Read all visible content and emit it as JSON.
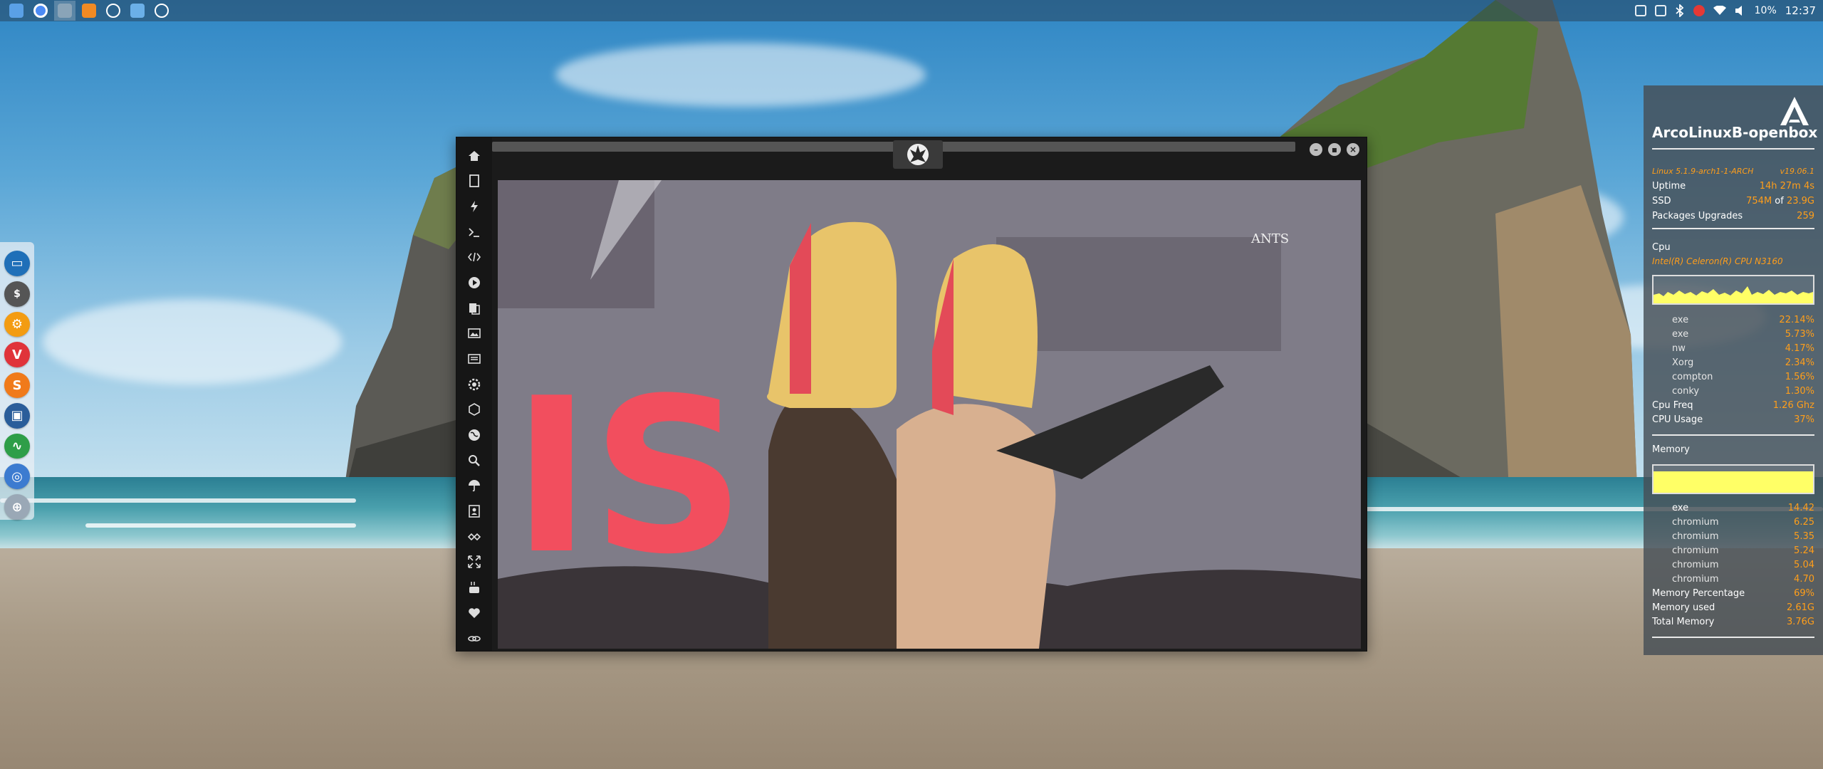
{
  "top_panel": {
    "launchers": [
      "file-manager-icon",
      "chrome-icon",
      "workspace-icon",
      "sublime-icon",
      "terminal-icon",
      "folder-icon",
      "screenshot-icon"
    ],
    "volume": "10%",
    "clock": "12:37"
  },
  "dock": {
    "items": [
      "file-manager-icon",
      "terminal-icon",
      "settings-icon",
      "vivaldi-icon",
      "sublime-icon",
      "workspace-icon",
      "system-monitor-icon",
      "chrome-icon",
      "network-icon"
    ]
  },
  "window": {
    "sidebar_icons": [
      "home-icon",
      "document-icon",
      "lightning-icon",
      "terminal-icon",
      "code-icon",
      "play-icon",
      "files-icon",
      "image-icon",
      "news-icon",
      "settings-icon",
      "hexagon-icon",
      "globe-icon",
      "search-icon",
      "umbrella-icon",
      "contact-icon",
      "sync-icon",
      "expand-icon",
      "youtube-icon",
      "heart-icon",
      "link-icon"
    ],
    "video_watermark": "ANTS"
  },
  "conky": {
    "hostname": "ArcoLinuxB-openbox",
    "kernel": "Linux 5.1.9-arch1-1-ARCH",
    "version": "v19.06.1",
    "uptime_label": "Uptime",
    "uptime": "14h 27m 4s",
    "ssd_label": "SSD",
    "ssd_used": "754M",
    "ssd_of": "of",
    "ssd_total": "23.9G",
    "packages_label": "Packages Upgrades",
    "packages": "259",
    "cpu_title": "Cpu",
    "cpu_model": "Intel(R) Celeron(R) CPU  N3160",
    "cpu_processes": [
      {
        "name": "exe",
        "value": "22.14%"
      },
      {
        "name": "exe",
        "value": "5.73%"
      },
      {
        "name": "nw",
        "value": "4.17%"
      },
      {
        "name": "Xorg",
        "value": "2.34%"
      },
      {
        "name": "compton",
        "value": "1.56%"
      },
      {
        "name": "conky",
        "value": "1.30%"
      }
    ],
    "cpu_freq_label": "Cpu Freq",
    "cpu_freq": "1.26 Ghz",
    "cpu_usage_label": "CPU Usage",
    "cpu_usage": "37%",
    "memory_title": "Memory",
    "mem_processes": [
      {
        "name": "exe",
        "value": "14.42"
      },
      {
        "name": "chromium",
        "value": "6.25"
      },
      {
        "name": "chromium",
        "value": "5.35"
      },
      {
        "name": "chromium",
        "value": "5.24"
      },
      {
        "name": "chromium",
        "value": "5.04"
      },
      {
        "name": "chromium",
        "value": "4.70"
      }
    ],
    "mem_pct_label": "Memory Percentage",
    "mem_pct": "69%",
    "mem_used_label": "Memory used",
    "mem_used": "2.61G",
    "mem_total_label": "Total Memory",
    "mem_total": "3.76G",
    "accent_color": "#ff9e1a",
    "graph_color": "#ffff66"
  }
}
